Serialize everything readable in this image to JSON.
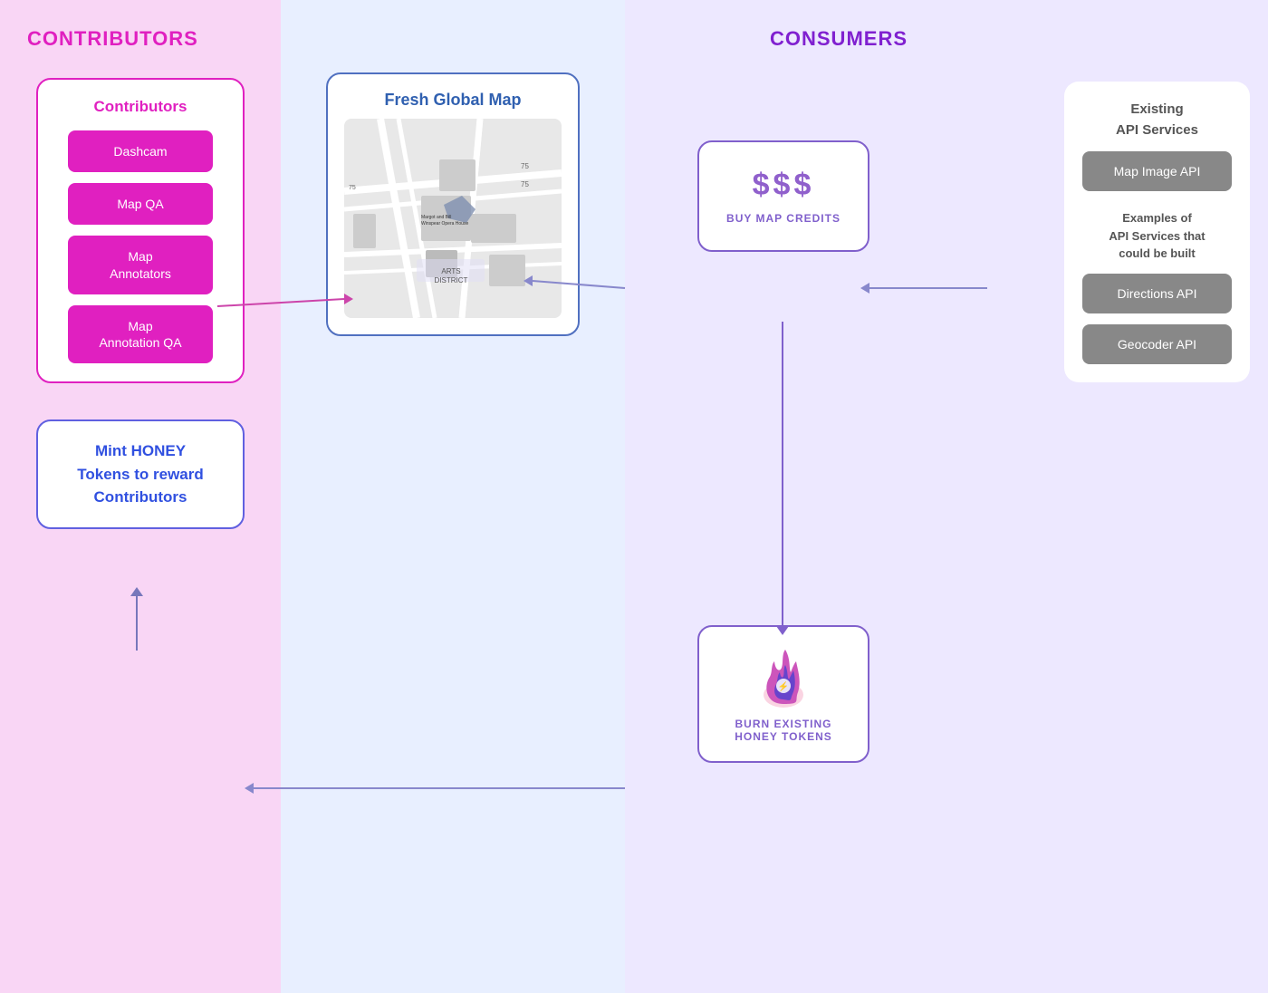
{
  "contributors": {
    "title": "CONTRIBUTORS",
    "box_title": "Contributors",
    "buttons": [
      "Dashcam",
      "Map QA",
      "Map\nAnnotators",
      "Map\nAnnotation QA"
    ]
  },
  "mint": {
    "text": "Mint HONEY Tokens to reward Contributors"
  },
  "map": {
    "title": "Fresh Global Map"
  },
  "consumers": {
    "title": "CONSUMERS",
    "buy_credits": {
      "dollar": "$$$",
      "label": "BUY MAP CREDITS"
    },
    "burn_tokens": {
      "label": "BURN EXISTING\nHONEY TOKENS"
    },
    "api_services": {
      "title": "Existing\nAPI Services",
      "map_image_api": "Map Image API",
      "examples_title": "Examples of\nAPI Services that\ncould be built",
      "directions_api": "Directions API",
      "geocoder_api": "Geocoder API"
    }
  }
}
